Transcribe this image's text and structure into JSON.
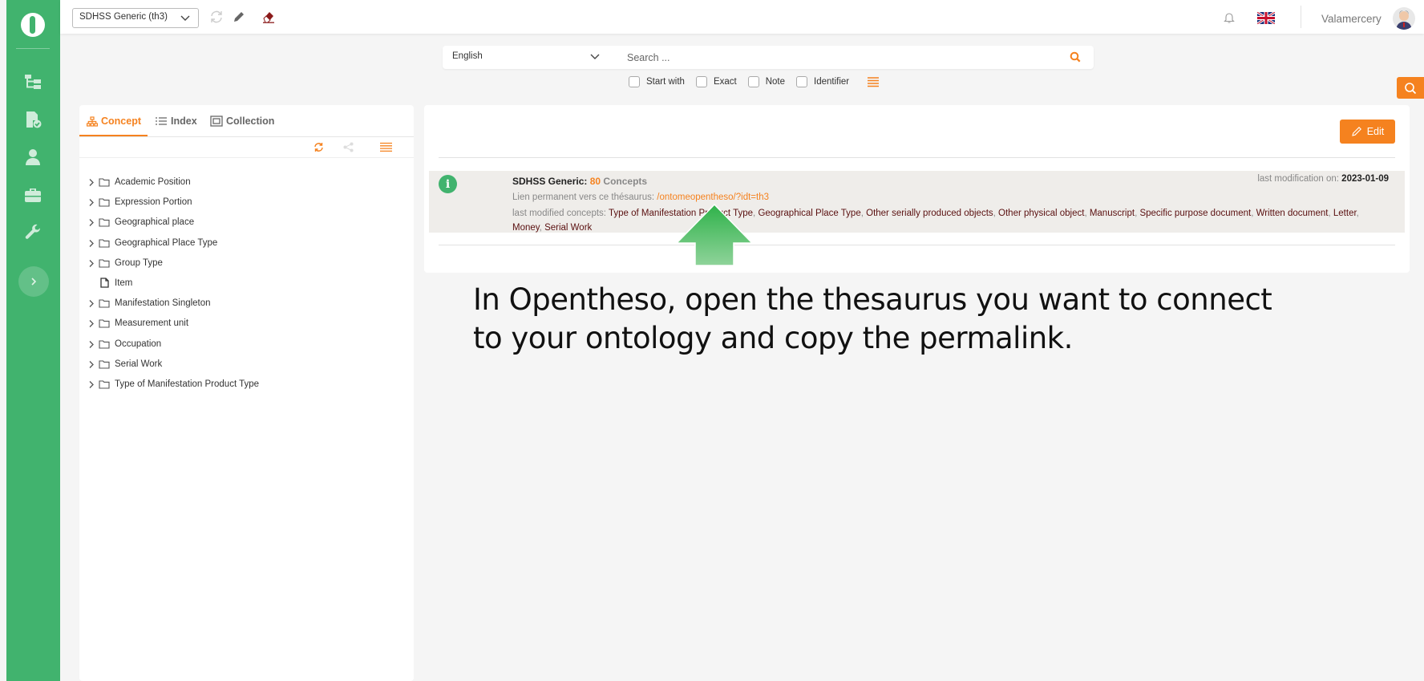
{
  "app": {
    "brand_color": "#41b36e",
    "accent_color": "#f5821f"
  },
  "sidebar": {
    "items": [
      {
        "icon": "tree-icon"
      },
      {
        "icon": "document-check-icon"
      },
      {
        "icon": "user-icon"
      },
      {
        "icon": "briefcase-icon"
      },
      {
        "icon": "wrench-icon"
      }
    ]
  },
  "topbar": {
    "thesaurus_selected": "SDHSS Generic (th3)",
    "username": "Valamercery"
  },
  "search": {
    "language": "English",
    "placeholder": "Search ...",
    "filters": [
      "Start with",
      "Exact",
      "Note",
      "Identifier"
    ]
  },
  "left_panel": {
    "tabs": [
      "Concept",
      "Index",
      "Collection"
    ],
    "tree": [
      {
        "label": "Academic Position",
        "type": "folder"
      },
      {
        "label": "Expression Portion",
        "type": "folder"
      },
      {
        "label": "Geographical place",
        "type": "folder"
      },
      {
        "label": "Geographical Place Type",
        "type": "folder"
      },
      {
        "label": "Group Type",
        "type": "folder"
      },
      {
        "label": "Item",
        "type": "leaf"
      },
      {
        "label": "Manifestation Singleton",
        "type": "folder"
      },
      {
        "label": "Measurement unit",
        "type": "folder"
      },
      {
        "label": "Occupation",
        "type": "folder"
      },
      {
        "label": "Serial Work",
        "type": "folder"
      },
      {
        "label": "Type of Manifestation Product Type",
        "type": "folder"
      }
    ]
  },
  "right_panel": {
    "edit_label": "Edit",
    "info": {
      "name": "SDHSS Generic:",
      "count": "80",
      "count_label": "Concepts",
      "last_modification_label": "last modification on:",
      "last_modification_date": "2023-01-09",
      "permalink_label": "Lien permanent vers ce thésaurus:",
      "permalink_url": "/ontomeopentheso/?idt=th3",
      "last_modified_label": "last modified concepts:",
      "last_modified_concepts": [
        "Type of Manifestation Product Type",
        "Geographical Place Type",
        "Other serially produced objects",
        "Other physical object",
        "Manuscript",
        "Specific purpose document",
        "Written document",
        "Letter",
        "Money",
        "Serial Work"
      ]
    }
  },
  "annotation": {
    "text": "In Opentheso, open the thesaurus you want to connect to your ontology and copy the permalink."
  }
}
